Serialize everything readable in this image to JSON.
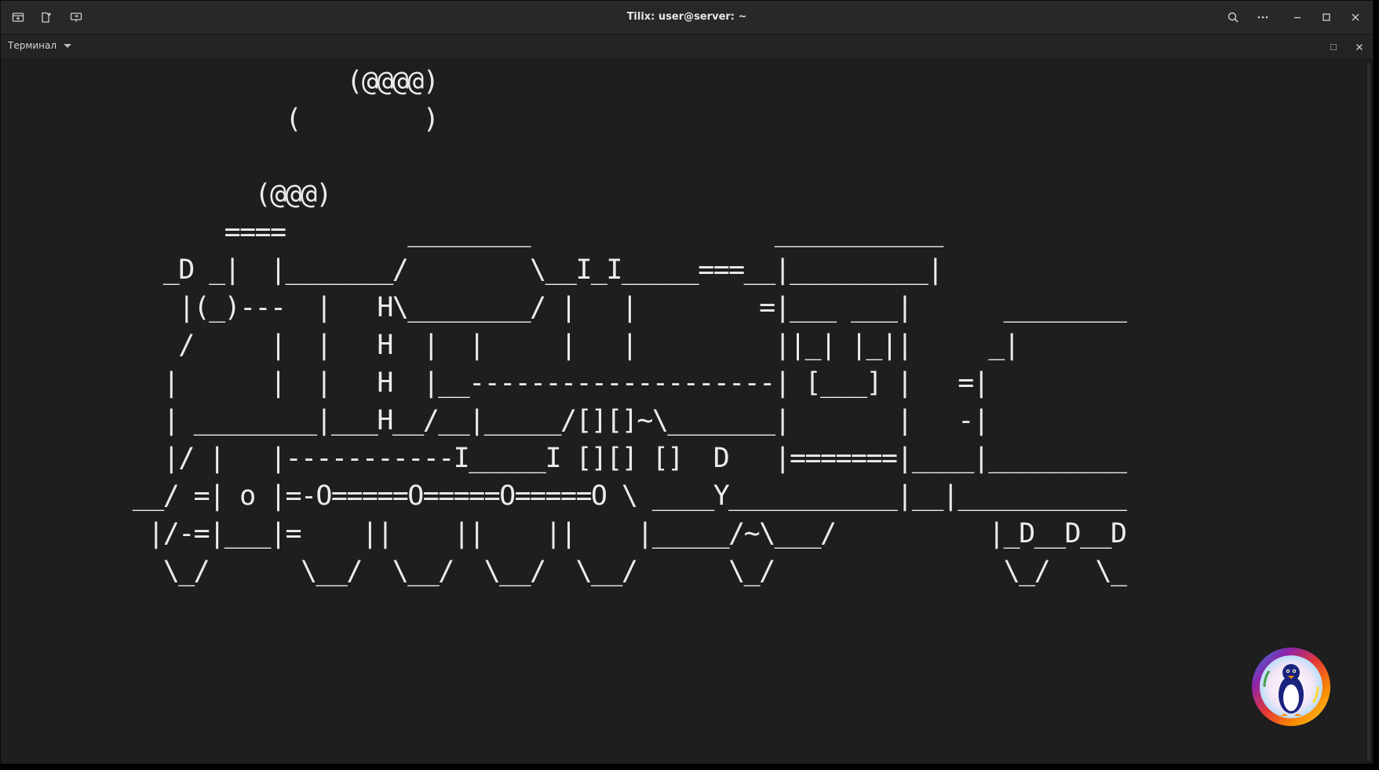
{
  "window": {
    "title": "Tilix: user@server: ~"
  },
  "titlebar": {
    "left_icons": [
      "add-terminal-icon",
      "add-session-icon",
      "session-sidebar-icon"
    ],
    "right_icons": [
      "search-icon",
      "more-icon",
      "minimize-icon",
      "maximize-icon",
      "close-icon"
    ]
  },
  "session": {
    "menu_label": "Терминал",
    "right_icons": [
      "maximize-terminal-icon",
      "close-terminal-icon"
    ]
  },
  "terminal": {
    "lines": [
      "                      (@@@@)",
      "                  (        )",
      "",
      "                (@@@)",
      "              ====        ________                ___________",
      "          _D _|  |_______/        \\__I_I_____===__|_________|",
      "           |(_)---  |   H\\________/ |   |        =|___ ___|      ________",
      "           /     |  |   H  |  |     |   |         ||_| |_||     _|",
      "          |      |  |   H  |__--------------------| [___] |   =|",
      "          | ________|___H__/__|_____/[][]~\\_______|       |   -|",
      "          |/ |   |-----------I_____I [][] []  D   |=======|____|_________",
      "        __/ =| o |=-O=====O=====O=====O \\ ____Y___________|__|___________",
      "         |/-=|___|=    ||    ||    ||    |_____/~\\___/          |_D__D__D",
      "          \\_/      \\__/  \\__/  \\__/  \\__/      \\_/               \\_/   \\_"
    ]
  },
  "badge": {
    "icon": "penguin-logo-icon",
    "colors": [
      "#e53935",
      "#fb8c00",
      "#fdd835",
      "#43a047",
      "#1e88e5",
      "#8e24aa"
    ]
  },
  "colors": {
    "titlebar_bg": "#282828",
    "terminal_bg": "#1e1e1e",
    "terminal_fg": "#ececec"
  }
}
